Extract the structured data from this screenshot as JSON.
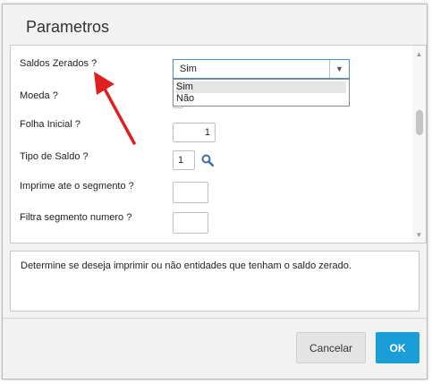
{
  "dialog": {
    "title": "Parametros"
  },
  "params": [
    {
      "label": "Saldos Zerados ?",
      "value": "Sim"
    },
    {
      "label": "Moeda ?",
      "value": ""
    },
    {
      "label": "Folha Inicial ?",
      "value": "1"
    },
    {
      "label": "Tipo de Saldo ?",
      "value": "1"
    },
    {
      "label": "Imprime ate o segmento ?",
      "value": ""
    },
    {
      "label": "Filtra segmento numero ?",
      "value": ""
    }
  ],
  "dropdown": {
    "options": [
      "Sim",
      "Não"
    ],
    "highlighted": "Sim"
  },
  "help_text": "Determine se deseja imprimir ou não entidades que tenham o saldo zerado.",
  "buttons": {
    "cancel": "Cancelar",
    "ok": "OK"
  },
  "colors": {
    "accent": "#1a9ed8",
    "annotation_arrow": "#e02020"
  },
  "icons": {
    "combo": "chevron-down-icon",
    "lookup": "search-icon"
  }
}
